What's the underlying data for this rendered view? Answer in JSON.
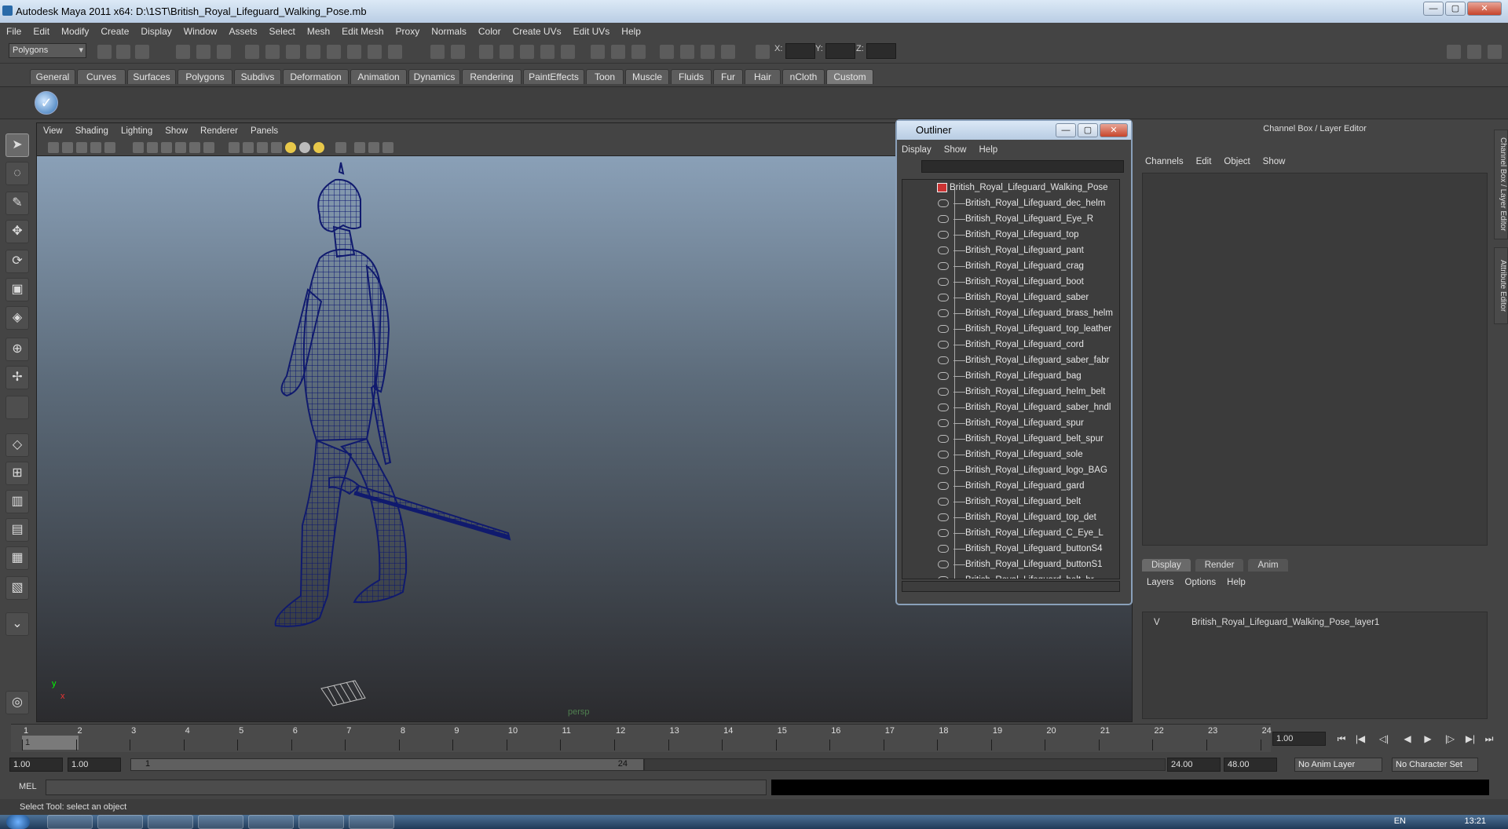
{
  "window": {
    "title": "Autodesk Maya 2011 x64: D:\\1ST\\British_Royal_Lifeguard_Walking_Pose.mb",
    "min": "—",
    "max": "▢",
    "close": "✕"
  },
  "menubar": [
    "File",
    "Edit",
    "Modify",
    "Create",
    "Display",
    "Window",
    "Assets",
    "Select",
    "Mesh",
    "Edit Mesh",
    "Proxy",
    "Normals",
    "Color",
    "Create UVs",
    "Edit UVs",
    "Help"
  ],
  "statusline": {
    "mode": "Polygons",
    "x_label": "X:",
    "y_label": "Y:",
    "z_label": "Z:"
  },
  "shelf_tabs": [
    "General",
    "Curves",
    "Surfaces",
    "Polygons",
    "Subdivs",
    "Deformation",
    "Animation",
    "Dynamics",
    "Rendering",
    "PaintEffects",
    "Toon",
    "Muscle",
    "Fluids",
    "Fur",
    "Hair",
    "nCloth",
    "Custom"
  ],
  "shelf_active": "Custom",
  "viewport": {
    "menu": [
      "View",
      "Shading",
      "Lighting",
      "Show",
      "Renderer",
      "Panels"
    ],
    "camera": "persp",
    "axis_y": "y",
    "axis_x": "x"
  },
  "outliner": {
    "title": "Outliner",
    "menu": [
      "Display",
      "Show",
      "Help"
    ],
    "root": "British_Royal_Lifeguard_Walking_Pose",
    "items": [
      "British_Royal_Lifeguard_dec_helm",
      "British_Royal_Lifeguard_Eye_R",
      "British_Royal_Lifeguard_top",
      "British_Royal_Lifeguard_pant",
      "British_Royal_Lifeguard_crag",
      "British_Royal_Lifeguard_boot",
      "British_Royal_Lifeguard_saber",
      "British_Royal_Lifeguard_brass_helm",
      "British_Royal_Lifeguard_top_leather",
      "British_Royal_Lifeguard_cord",
      "British_Royal_Lifeguard_saber_fabr",
      "British_Royal_Lifeguard_bag",
      "British_Royal_Lifeguard_helm_belt",
      "British_Royal_Lifeguard_saber_hndl",
      "British_Royal_Lifeguard_spur",
      "British_Royal_Lifeguard_belt_spur",
      "British_Royal_Lifeguard_sole",
      "British_Royal_Lifeguard_logo_BAG",
      "British_Royal_Lifeguard_gard",
      "British_Royal_Lifeguard_belt",
      "British_Royal_Lifeguard_top_det",
      "British_Royal_Lifeguard_C_Eye_L",
      "British_Royal_Lifeguard_buttonS4",
      "British_Royal_Lifeguard_buttonS1",
      "British_Royal_Lifeguard_belt_br"
    ]
  },
  "channelbox": {
    "title": "Channel Box / Layer Editor",
    "menu": [
      "Channels",
      "Edit",
      "Object",
      "Show"
    ],
    "layer_tabs": [
      "Display",
      "Render",
      "Anim"
    ],
    "layer_menu": [
      "Layers",
      "Options",
      "Help"
    ],
    "layer_visible": "V",
    "layer_name": "British_Royal_Lifeguard_Walking_Pose_layer1",
    "side_tab1": "Channel Box / Layer Editor",
    "side_tab2": "Attribute Editor"
  },
  "timeline": {
    "ticks": [
      "1",
      "2",
      "3",
      "4",
      "5",
      "6",
      "7",
      "8",
      "9",
      "10",
      "11",
      "12",
      "13",
      "14",
      "15",
      "16",
      "17",
      "18",
      "19",
      "20",
      "21",
      "22",
      "23",
      "24"
    ],
    "current_marker": "1",
    "current_frame": "1.00"
  },
  "range": {
    "start": "1.00",
    "start2": "1.00",
    "slider_start": "1",
    "slider_end": "24",
    "end": "24.00",
    "end2": "48.00",
    "anim_layer": "No Anim Layer",
    "char_set": "No Character Set"
  },
  "command": {
    "label": "MEL"
  },
  "helpline": "Select Tool: select an object",
  "taskbar": {
    "clock": "13:21",
    "lang": "EN"
  },
  "colors": {
    "wireframe": "#101a6e",
    "viewport_top": "#8aa0b7",
    "viewport_bottom": "#2b2b2e"
  }
}
